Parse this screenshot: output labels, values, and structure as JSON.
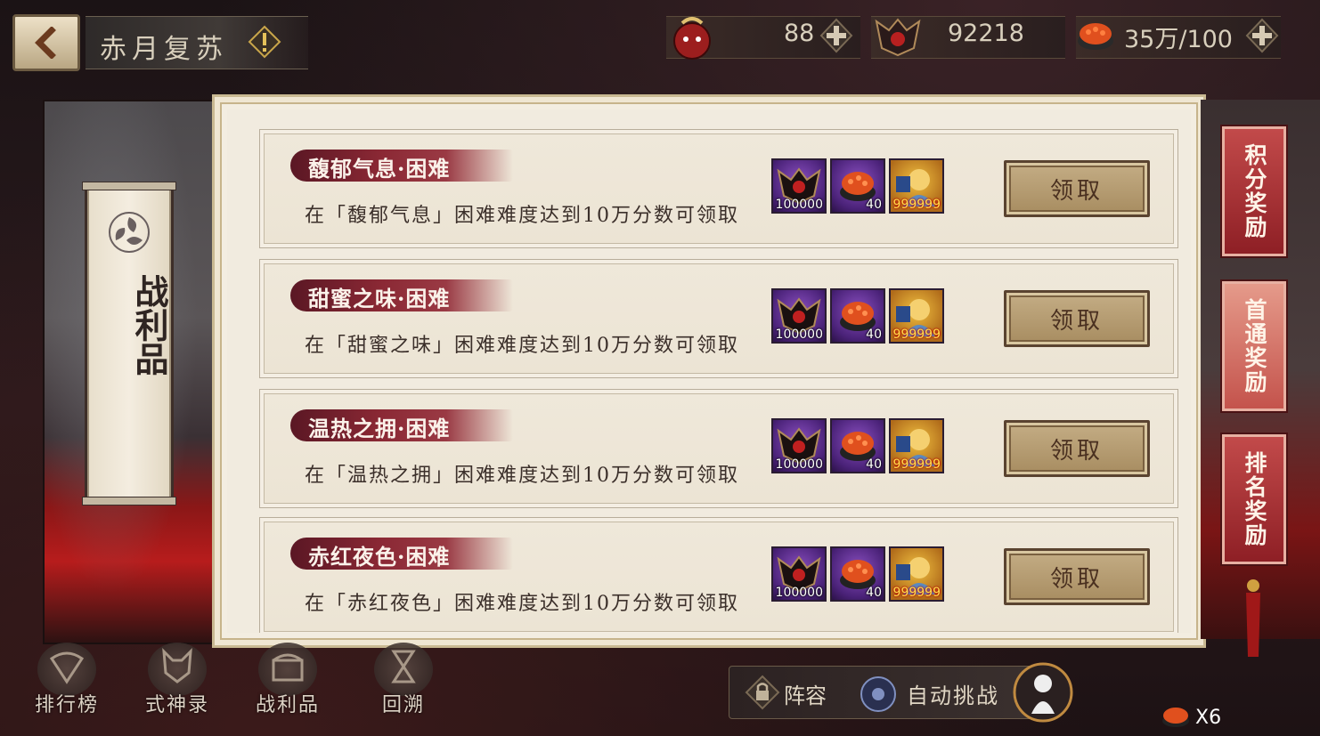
{
  "header": {
    "title": "赤月复苏",
    "resources": [
      {
        "icon": "red-mask-icon",
        "value": "88"
      },
      {
        "icon": "demon-mask-icon",
        "value": "92218"
      },
      {
        "icon": "sushi-icon",
        "value": "35万/100"
      }
    ]
  },
  "left_panel": {
    "tag_label": "战利品"
  },
  "tasks": [
    {
      "name": "馥郁气息·困难",
      "desc": "在「馥郁气息」困难难度达到10万分数可领取",
      "rewards": [
        {
          "icon": "demon-mask-icon",
          "count": "100000"
        },
        {
          "icon": "sushi-icon",
          "count": "40"
        },
        {
          "icon": "portrait-icon",
          "count": "999999"
        }
      ],
      "button": "领取"
    },
    {
      "name": "甜蜜之味·困难",
      "desc": "在「甜蜜之味」困难难度达到10万分数可领取",
      "rewards": [
        {
          "icon": "demon-mask-icon",
          "count": "100000"
        },
        {
          "icon": "sushi-icon",
          "count": "40"
        },
        {
          "icon": "portrait-icon",
          "count": "999999"
        }
      ],
      "button": "领取"
    },
    {
      "name": "温热之拥·困难",
      "desc": "在「温热之拥」困难难度达到10万分数可领取",
      "rewards": [
        {
          "icon": "demon-mask-icon",
          "count": "100000"
        },
        {
          "icon": "sushi-icon",
          "count": "40"
        },
        {
          "icon": "portrait-icon",
          "count": "999999"
        }
      ],
      "button": "领取"
    },
    {
      "name": "赤红夜色·困难",
      "desc": "在「赤红夜色」困难难度达到10万分数可领取",
      "rewards": [
        {
          "icon": "demon-mask-icon",
          "count": "100000"
        },
        {
          "icon": "sushi-icon",
          "count": "40"
        },
        {
          "icon": "portrait-icon",
          "count": "999999"
        }
      ],
      "button": "领取"
    }
  ],
  "right_tabs": [
    {
      "label": "积分奖励",
      "active": false
    },
    {
      "label": "首通奖励",
      "active": true
    },
    {
      "label": "排名奖励",
      "active": false
    }
  ],
  "bottom_nav": [
    {
      "label": "排行榜",
      "icon": "fan-icon"
    },
    {
      "label": "式神录",
      "icon": "fox-mask-icon"
    },
    {
      "label": "战利品",
      "icon": "chest-icon"
    },
    {
      "label": "回溯",
      "icon": "hourglass-icon"
    }
  ],
  "bottom_actions": {
    "lineup": "阵容",
    "auto_challenge": "自动挑战",
    "multiplier": "X6"
  },
  "colors": {
    "accent_red": "#8a2834",
    "panel_bg": "#f1ebdf",
    "button_gold": "#b89d70"
  }
}
